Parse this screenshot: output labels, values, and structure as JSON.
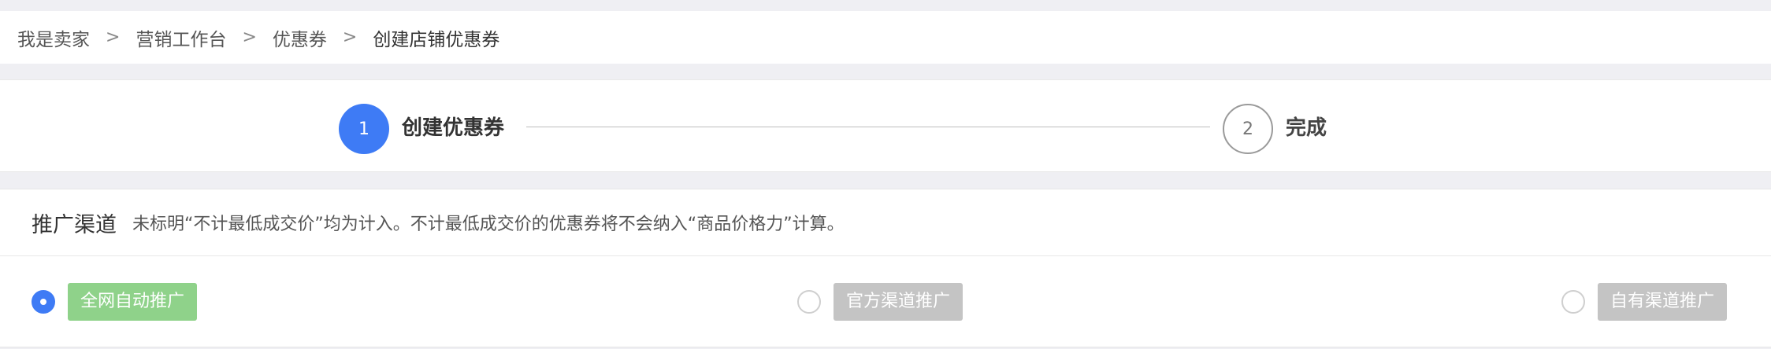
{
  "breadcrumb": {
    "items": [
      "我是卖家",
      "营销工作台",
      "优惠券",
      "创建店铺优惠券"
    ],
    "separator": ">"
  },
  "steps": [
    {
      "number": "1",
      "label": "创建优惠券",
      "active": true
    },
    {
      "number": "2",
      "label": "完成",
      "active": false
    }
  ],
  "promotion": {
    "title": "推广渠道",
    "note": "未标明“不计最低成交价”均为计入。不计最低成交价的优惠券将不会纳入“商品价格力”计算。",
    "options": [
      {
        "label": "全网自动推广",
        "selected": true
      },
      {
        "label": "官方渠道推广",
        "selected": false
      },
      {
        "label": "自有渠道推广",
        "selected": false
      }
    ]
  },
  "colors": {
    "accent": "#3e7bf5",
    "selected_option_bg": "#8fd28a",
    "disabled_option_bg": "#c4c4c4",
    "page_bg": "#efeff3"
  }
}
